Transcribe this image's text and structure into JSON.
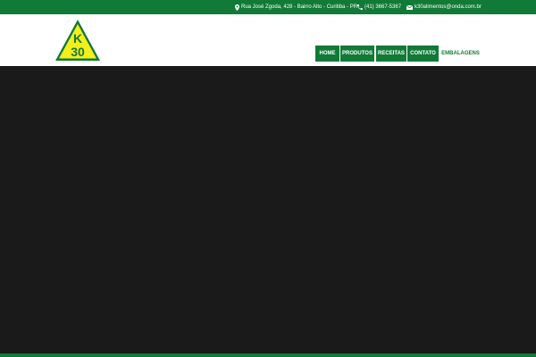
{
  "topbar": {
    "address": "Rua José Zgoda, 428 - Bairro Alto - Curitiba - PR",
    "phone": "(41) 3667-5367",
    "email": "k30alimentos@onda.com.br",
    "address_icon": "map-marker-icon",
    "phone_icon": "phone-icon",
    "email_icon": "envelope-icon"
  },
  "logo": {
    "line1": "K",
    "line2": "30"
  },
  "nav": {
    "items": [
      {
        "label": "HOME"
      },
      {
        "label": "PRODUTOS"
      },
      {
        "label": "RECEITAS"
      },
      {
        "label": "CONTATO"
      },
      {
        "label": "EMBALAGENS"
      }
    ]
  },
  "colors": {
    "brand_green": "#117a37",
    "logo_yellow": "#f4ee1d",
    "hero_background": "#1a1a1a"
  }
}
